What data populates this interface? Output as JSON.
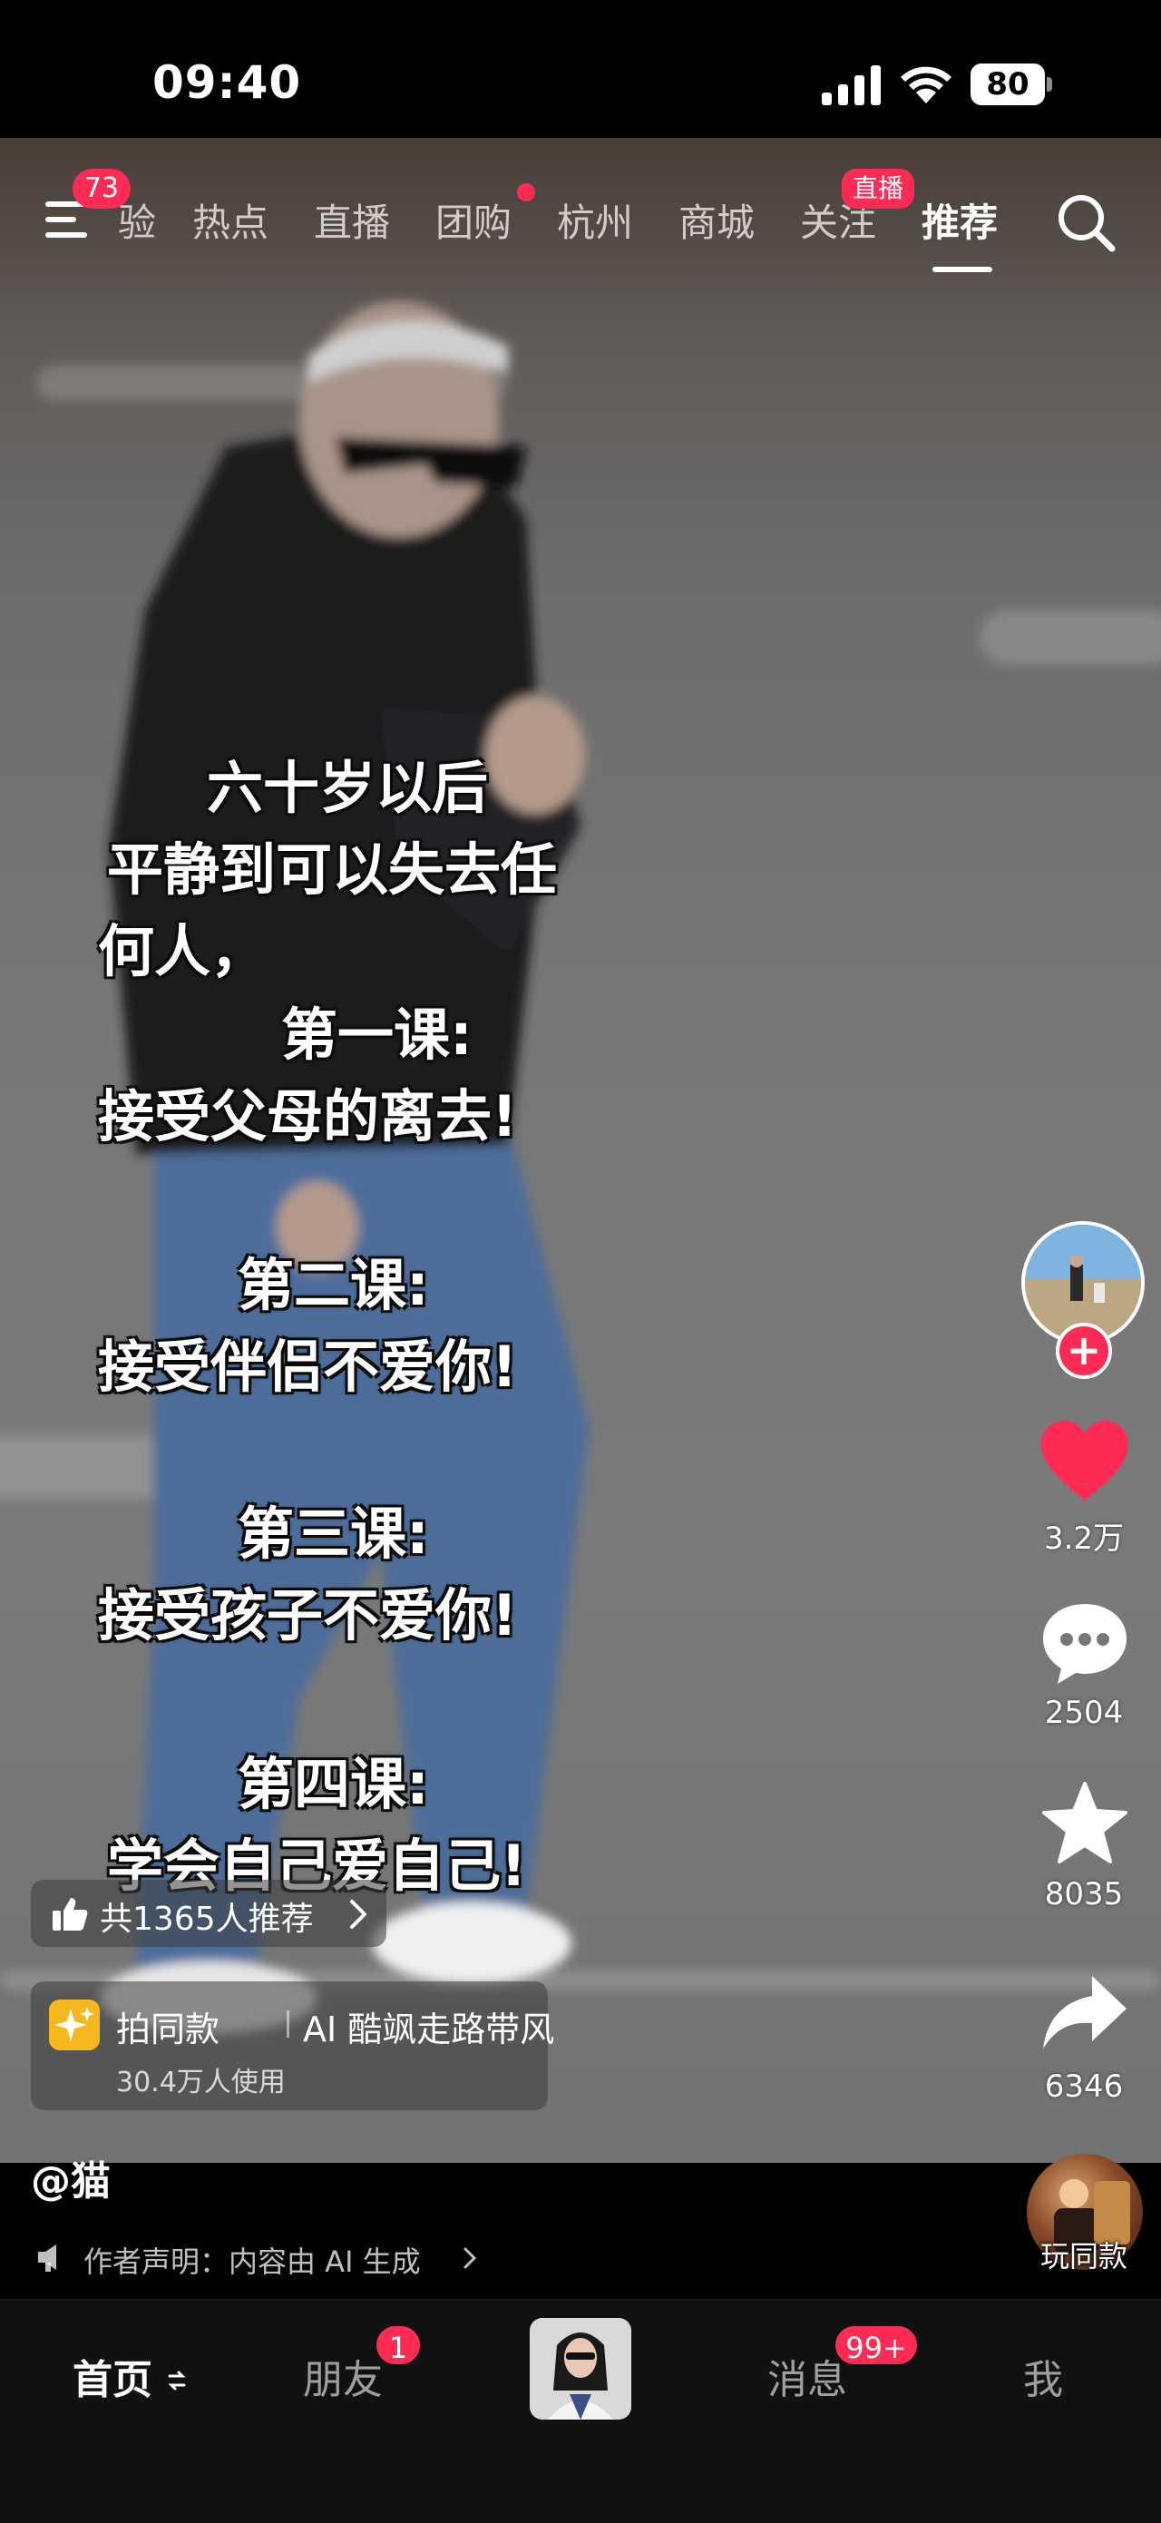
{
  "status_bar": {
    "time": "09:40",
    "battery": "80"
  },
  "top_nav": {
    "menu_badge": "73",
    "tabs": [
      "验",
      "热点",
      "直播",
      "团购",
      "杭州",
      "商城",
      "关注",
      "推荐"
    ],
    "active_tab": "推荐",
    "live_badge": "直播"
  },
  "caption_lines": [
    "六十岁以后",
    "平静到可以失去任",
    "何人，",
    "第一课:",
    "接受父母的离去!",
    "第二课:",
    "接受伴侣不爱你!",
    "第三课:",
    "接受孩子不爱你!",
    "第四课:",
    "学会自己爱自己!"
  ],
  "actions": {
    "likes": "3.2万",
    "comments": "2504",
    "favorites": "8035",
    "shares": "6346"
  },
  "recommend": {
    "text": "共1365人推荐"
  },
  "template": {
    "title": "拍同款",
    "name": "AI 酷飒走路带风",
    "usage": "30.4万人使用"
  },
  "author": "@猫",
  "declaration": "作者声明：内容由 AI 生成",
  "play_same_label": "玩同款",
  "bottom_nav": {
    "home": "首页",
    "friends": "朋友",
    "friends_badge": "1",
    "messages": "消息",
    "messages_badge": "99+",
    "me": "我"
  },
  "colors": {
    "accent": "#fe2c55",
    "like": "#fe2c55",
    "bottom_bar": "#111111"
  },
  "icons": [
    "menu-icon",
    "search-icon",
    "heart-icon",
    "comment-icon",
    "star-icon",
    "share-icon",
    "thumb-up-icon",
    "sparkle-icon",
    "speaker-icon",
    "refresh-icon"
  ]
}
